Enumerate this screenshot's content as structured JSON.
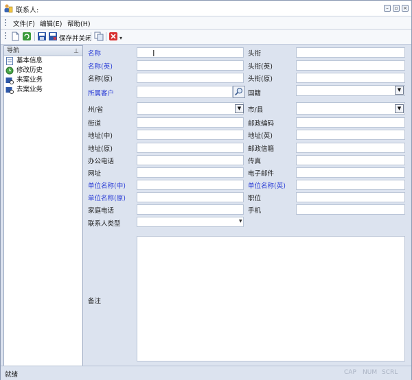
{
  "window": {
    "title": "联系人:"
  },
  "menu": {
    "file": "文件(F)",
    "edit": "编辑(E)",
    "help": "帮助(H)"
  },
  "toolbar": {
    "save_close": "保存并关闭"
  },
  "nav": {
    "header": "导航",
    "items": [
      {
        "label": "基本信息",
        "icon": "contact-card-icon"
      },
      {
        "label": "修改历史",
        "icon": "history-icon"
      },
      {
        "label": "来案业务",
        "icon": "incoming-case-icon"
      },
      {
        "label": "去案业务",
        "icon": "outgoing-case-icon"
      }
    ]
  },
  "form": {
    "name": "名称",
    "name_en": "名称(英)",
    "name_orig": "名称(原)",
    "customer": "所属客户",
    "state": "州/省",
    "street": "街道",
    "address_cn": "地址(中)",
    "address_orig": "地址(原)",
    "office_phone": "办公电话",
    "website": "网址",
    "org_cn": "单位名称(中)",
    "org_orig": "单位名称(原)",
    "home_phone": "家庭电话",
    "contact_type": "联系人类型",
    "title": "头衔",
    "title_en": "头衔(英)",
    "title_orig": "头衔(原)",
    "nationality": "国籍",
    "city": "市/县",
    "postcode": "邮政编码",
    "address_en": "地址(英)",
    "postbox": "邮政信箱",
    "fax": "传真",
    "email": "电子邮件",
    "org_en": "单位名称(英)",
    "position": "职位",
    "mobile": "手机",
    "notes": "备注"
  },
  "status": {
    "text": "就绪",
    "cap": "CAP",
    "num": "NUM",
    "scrl": "SCRL"
  }
}
